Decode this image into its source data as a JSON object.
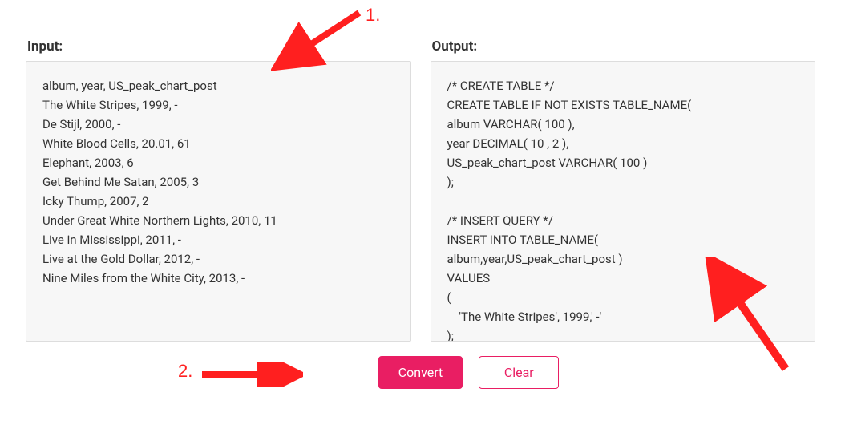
{
  "labels": {
    "input": "Input:",
    "output": "Output:"
  },
  "buttons": {
    "convert": "Convert",
    "clear": "Clear"
  },
  "input_text": "album, year, US_peak_chart_post\nThe White Stripes, 1999, -\nDe Stijl, 2000, -\nWhite Blood Cells, 20.01, 61\nElephant, 2003, 6\nGet Behind Me Satan, 2005, 3\nIcky Thump, 2007, 2\nUnder Great White Northern Lights, 2010, 11\nLive in Mississippi, 2011, -\nLive at the Gold Dollar, 2012, -\nNine Miles from the White City, 2013, -",
  "output_text": "/* CREATE TABLE */\nCREATE TABLE IF NOT EXISTS TABLE_NAME(\nalbum VARCHAR( 100 ),\nyear DECIMAL( 10 , 2 ),\nUS_peak_chart_post VARCHAR( 100 )\n);\n\n/* INSERT QUERY */\nINSERT INTO TABLE_NAME(\nalbum,year,US_peak_chart_post )\nVALUES\n(\n    'The White Stripes', 1999,' -'\n);",
  "annotations": {
    "num1": "1.",
    "num2": "2."
  }
}
